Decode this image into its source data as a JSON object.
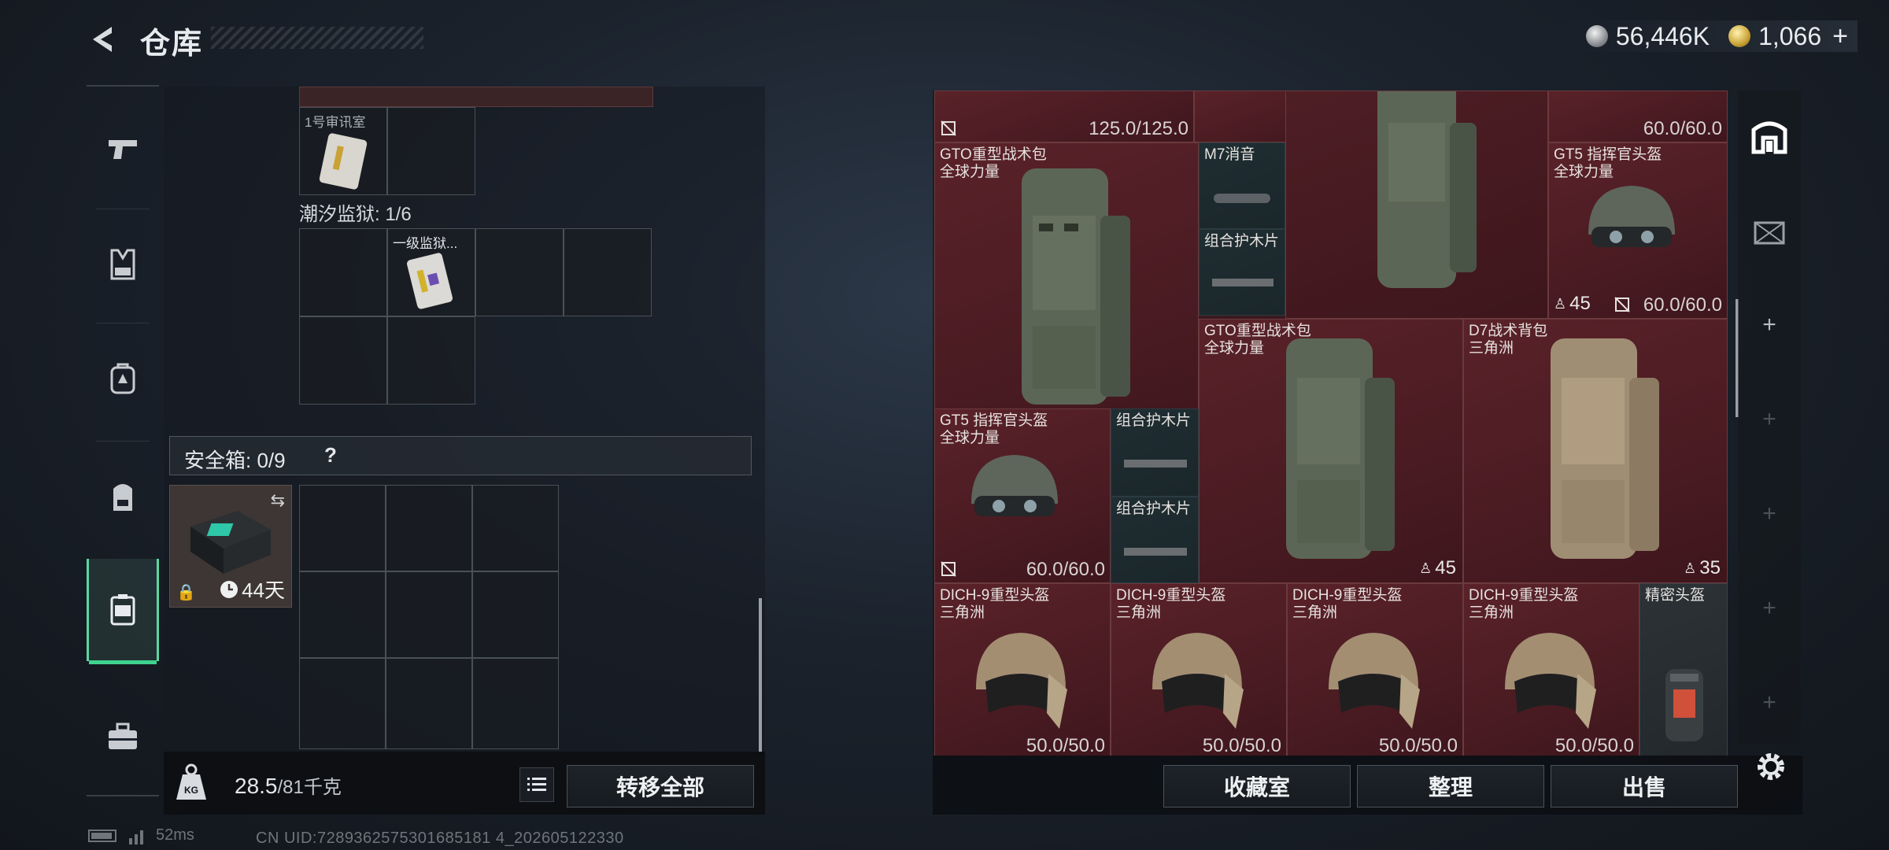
{
  "header": {
    "title": "仓库",
    "currency_silver": "56,446K",
    "currency_gold": "1,066",
    "currency_plus": "+"
  },
  "rail": {
    "items": [
      {
        "name": "weapons",
        "icon": "pistol-icon"
      },
      {
        "name": "armor",
        "icon": "vest-icon"
      },
      {
        "name": "backpack",
        "icon": "backpack-icon"
      },
      {
        "name": "chest-rig",
        "icon": "rig-icon"
      },
      {
        "name": "safe-box",
        "icon": "safe-case-icon",
        "active": true
      },
      {
        "name": "toolbox",
        "icon": "toolbox-icon"
      }
    ]
  },
  "left": {
    "slot_top_label": "1号审讯室",
    "section_label": "潮汐监狱: 1/6",
    "item_label": "一级监狱...",
    "safe_label": "安全箱: 0/9",
    "safe_help": "?",
    "safe_timer": "44天",
    "weight_value": "28.5",
    "weight_max": "/81千克",
    "transfer_all": "转移全部"
  },
  "right": {
    "top_dur_1": "125.0/125.0",
    "top_dur_2": "60.0/60.0",
    "items": [
      {
        "name": "GTO重型战术包\n全球力量",
        "count": "45"
      },
      {
        "name": "M7消音"
      },
      {
        "name": "组合护木片"
      },
      {
        "name": "GT5 指挥官头盔\n全球力量",
        "count": "45",
        "dur": "60.0/60.0"
      },
      {
        "name": "GTO重型战术包\n全球力量",
        "count": "45"
      },
      {
        "name": "D7战术背包\n三角洲",
        "count": "35"
      },
      {
        "name": "GT5 指挥官头盔\n全球力量",
        "dur": "60.0/60.0"
      },
      {
        "name": "组合护木片"
      },
      {
        "name": "组合护木片"
      },
      {
        "name": "DICH-9重型头盔\n三角洲",
        "dur": "50.0/50.0"
      },
      {
        "name": "DICH-9重型头盔\n三角洲",
        "dur": "50.0/50.0"
      },
      {
        "name": "DICH-9重型头盔\n三角洲",
        "dur": "50.0/50.0"
      },
      {
        "name": "DICH-9重型头盔\n三角洲",
        "dur": "50.0/50.0"
      },
      {
        "name": "精密头盔"
      }
    ],
    "btn_collection": "收藏室",
    "btn_sort": "整理",
    "btn_sell": "出售"
  },
  "status": {
    "ping": "52ms",
    "uid": "CN UID:7289362575301685181 4_202605122330"
  },
  "colors": {
    "accent": "#3ed38e",
    "item_bg_red": "#4a1b22"
  }
}
